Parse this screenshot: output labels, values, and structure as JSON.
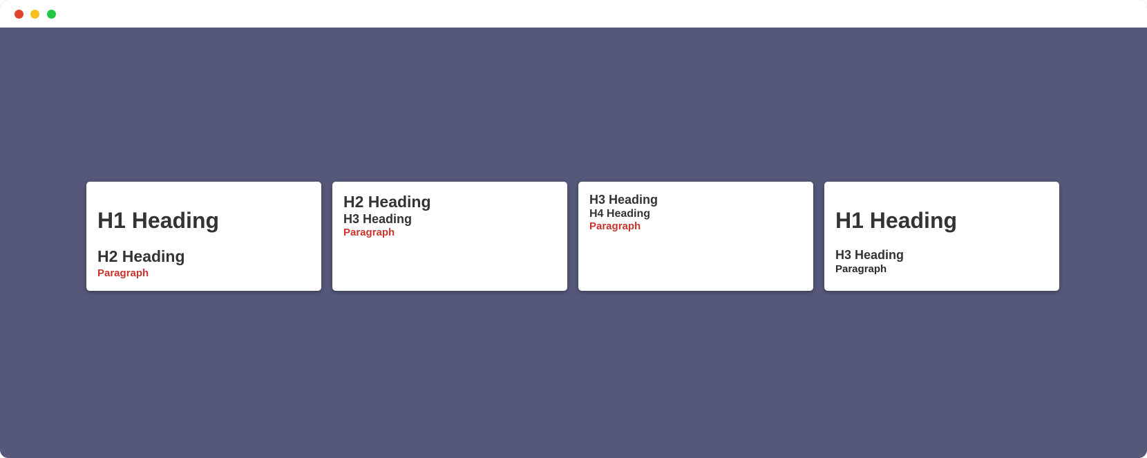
{
  "window": {
    "background": "#56587a",
    "titlebar_background": "#ffffff",
    "controls": [
      {
        "name": "close",
        "color": "#e0442c"
      },
      {
        "name": "minimize",
        "color": "#f5bf22"
      },
      {
        "name": "maximize",
        "color": "#22c744"
      }
    ]
  },
  "colors": {
    "heading": "#333333",
    "paragraph_accent": "#c8352e"
  },
  "cards": [
    {
      "primary": "H1 Heading",
      "secondary": "H2 Heading",
      "paragraph": "Paragraph"
    },
    {
      "primary": "H2 Heading",
      "secondary": "H3 Heading",
      "paragraph": "Paragraph"
    },
    {
      "primary": "H3 Heading",
      "secondary": "H4 Heading",
      "paragraph": "Paragraph"
    },
    {
      "primary": "H1 Heading",
      "secondary": "H3 Heading",
      "paragraph": "Paragraph"
    }
  ]
}
